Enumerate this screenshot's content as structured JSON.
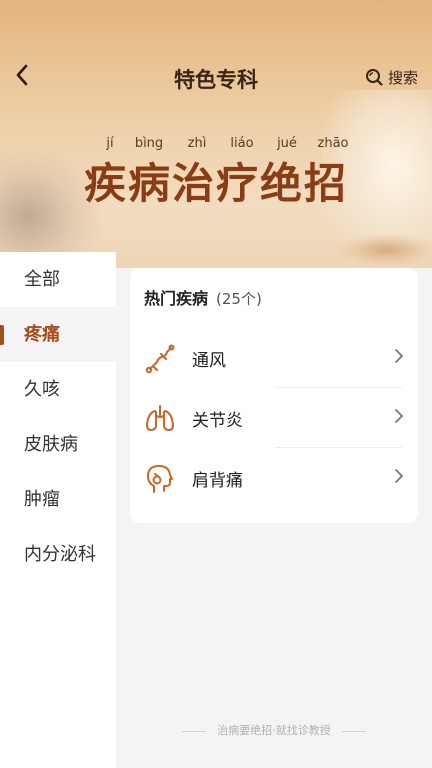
{
  "header": {
    "title": "特色专科",
    "search_label": "搜索"
  },
  "banner": {
    "pinyin": [
      "jí",
      "bìng",
      "zhì",
      "liáo",
      "jué",
      "zhāo"
    ],
    "title": "疾病治疗绝招"
  },
  "sidebar": {
    "items": [
      {
        "label": "全部",
        "active": false
      },
      {
        "label": "疼痛",
        "active": true
      },
      {
        "label": "久咳",
        "active": false
      },
      {
        "label": "皮肤病",
        "active": false
      },
      {
        "label": "肿瘤",
        "active": false
      },
      {
        "label": "内分泌科",
        "active": false
      }
    ]
  },
  "panel": {
    "title": "热门疾病",
    "count": "(25个)",
    "diseases": [
      {
        "label": "通风",
        "icon": "bone-joint-icon"
      },
      {
        "label": "关节炎",
        "icon": "lungs-icon"
      },
      {
        "label": "肩背痛",
        "icon": "head-neck-icon"
      }
    ]
  },
  "footer": {
    "slogan": "治病要绝招·就找诊教授"
  },
  "colors": {
    "accent": "#a34e1f",
    "title_brown": "#8a3d14",
    "icon_orange": "#c8682a"
  }
}
